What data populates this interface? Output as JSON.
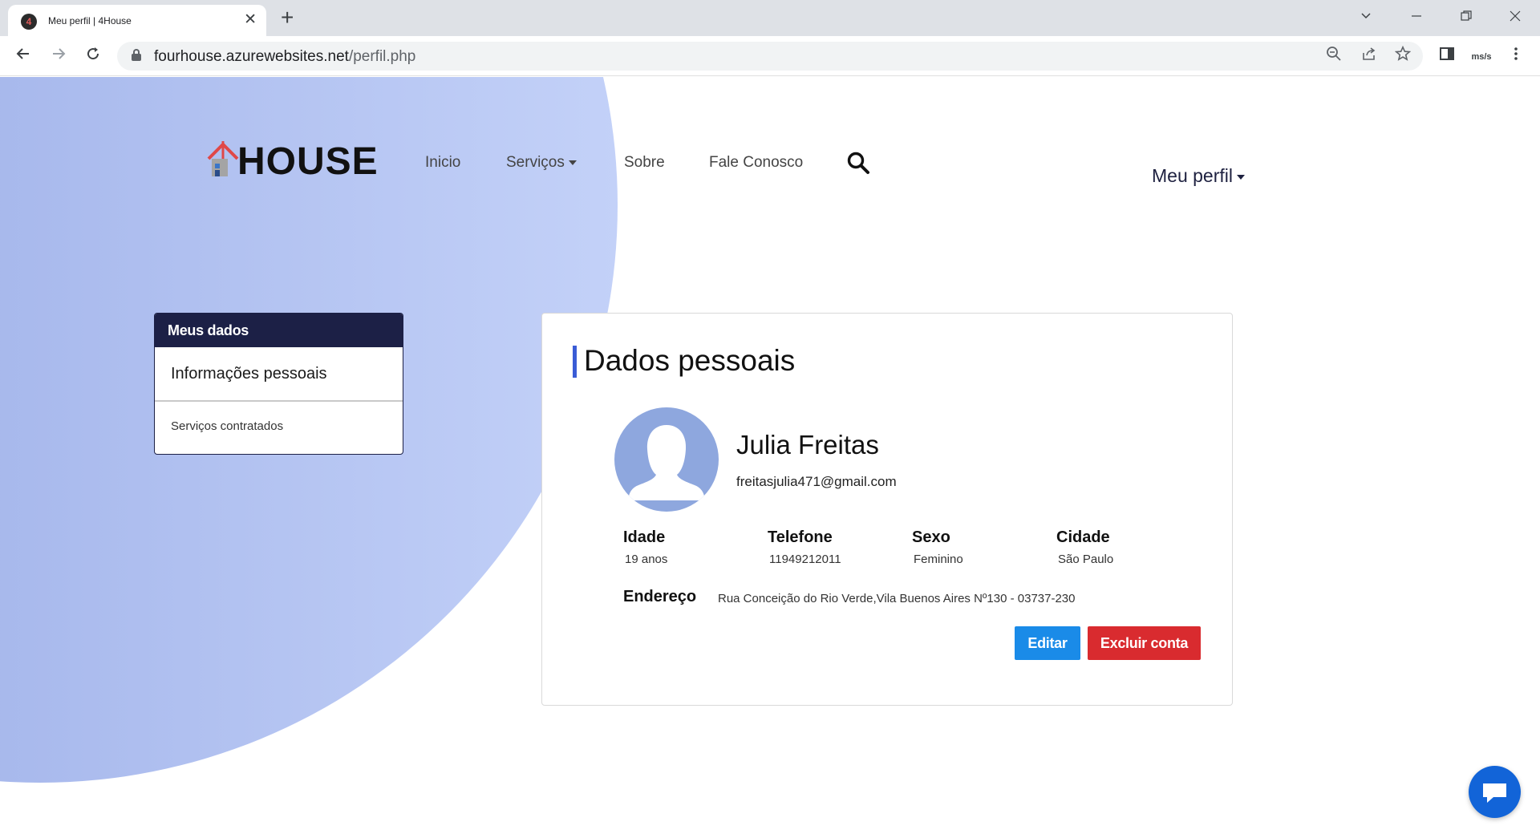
{
  "browser": {
    "tab_title": "Meu perfil | 4House",
    "favicon_letter": "4",
    "url_host": "fourhouse.azurewebsites.net",
    "url_path": "/perfil.php",
    "extension_label": "ms/s"
  },
  "site": {
    "logo_text": "HOUSE",
    "logo_digit": "4",
    "nav": {
      "inicio": "Inicio",
      "servicos": "Serviços",
      "sobre": "Sobre",
      "fale_conosco": "Fale Conosco"
    },
    "profile_menu": "Meu perfil"
  },
  "sidebar": {
    "header": "Meus dados",
    "items": [
      "Informações pessoais",
      "Serviços contratados"
    ]
  },
  "profile": {
    "section_title": "Dados pessoais",
    "name": "Julia Freitas",
    "email": "freitasjulia471@gmail.com",
    "fields": [
      {
        "label": "Idade",
        "value": "19 anos"
      },
      {
        "label": "Telefone",
        "value": "11949212011"
      },
      {
        "label": "Sexo",
        "value": "Feminino"
      },
      {
        "label": "Cidade",
        "value": "São Paulo"
      }
    ],
    "address_label": "Endereço",
    "address_value": "Rua Conceição do Rio Verde,Vila Buenos Aires Nº130 - 03737-230",
    "edit_button": "Editar",
    "delete_button": "Excluir conta"
  },
  "colors": {
    "navy": "#1c2046",
    "accent_blue": "#3a5cd6",
    "edit_blue": "#1a8be8",
    "delete_red": "#d92b2f",
    "chat_blue": "#1264d8"
  }
}
